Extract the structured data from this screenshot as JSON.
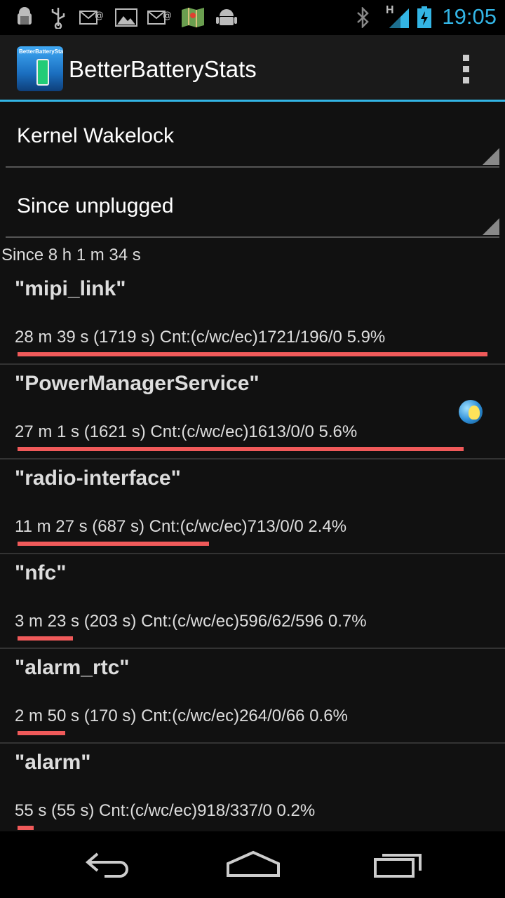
{
  "status_bar": {
    "time": "19:05",
    "network_label": "H",
    "left_icons": [
      "android-debug-icon",
      "usb-icon",
      "email-icon",
      "gallery-icon",
      "email-icon",
      "maps-icon",
      "android-icon"
    ],
    "right_icons": [
      "bluetooth-icon",
      "signal-icon",
      "battery-charging-icon"
    ]
  },
  "action_bar": {
    "app_icon_text": "BetterBatteryStats",
    "title": "BetterBatteryStats"
  },
  "spinners": {
    "stat_type": "Kernel Wakelock",
    "stat_period": "Since unplugged"
  },
  "since_label": "Since 8 h 1 m 34 s",
  "accent_color": "#33b5e5",
  "bar_color": "#f05a5a",
  "rows": [
    {
      "name": "\"mipi_link\"",
      "detail": "28 m 39 s  (1719 s) Cnt:(c/wc/ec)1721/196/0 5.9%",
      "percent": 5.9
    },
    {
      "name": "\"PowerManagerService\"",
      "detail": "27 m 1 s  (1621 s) Cnt:(c/wc/ec)1613/0/0 5.6%",
      "percent": 5.6
    },
    {
      "name": "\"radio-interface\"",
      "detail": "11 m 27 s  (687 s) Cnt:(c/wc/ec)713/0/0 2.4%",
      "percent": 2.4
    },
    {
      "name": "\"nfc\"",
      "detail": "3 m 23 s  (203 s) Cnt:(c/wc/ec)596/62/596 0.7%",
      "percent": 0.7
    },
    {
      "name": "\"alarm_rtc\"",
      "detail": "2 m 50 s  (170 s) Cnt:(c/wc/ec)264/0/66 0.6%",
      "percent": 0.6
    },
    {
      "name": "\"alarm\"",
      "detail": "55 s  (55 s) Cnt:(c/wc/ec)918/337/0 0.2%",
      "percent": 0.2
    }
  ],
  "navigation": [
    "back-icon",
    "home-icon",
    "recents-icon"
  ]
}
